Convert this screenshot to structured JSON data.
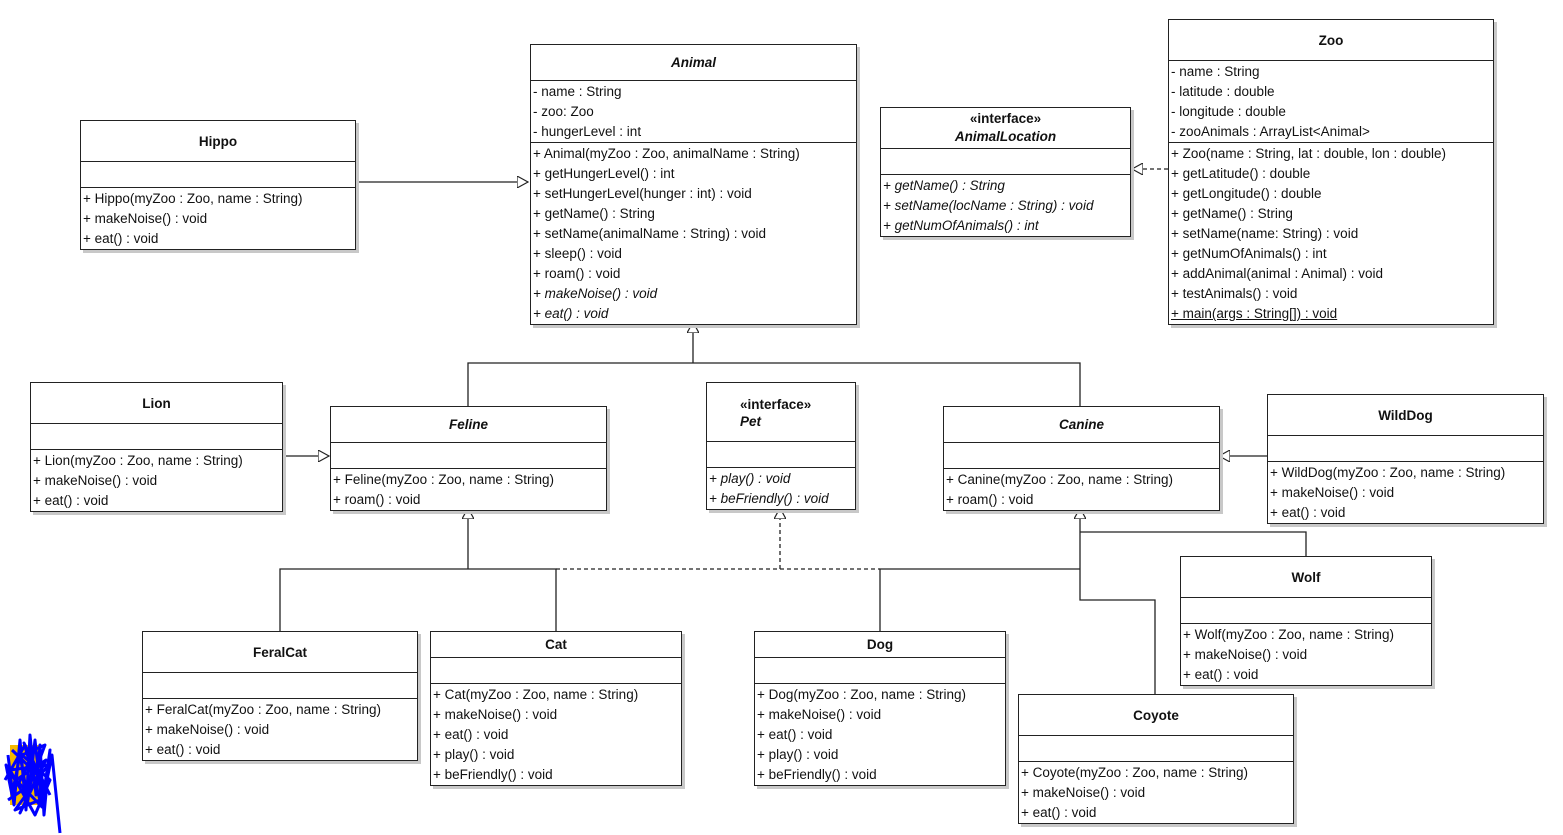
{
  "diagram": {
    "type": "UML class diagram",
    "classes": {
      "animal": {
        "name": "Animal",
        "abstract": true,
        "attributes": [
          "- name : String",
          "- zoo: Zoo",
          "- hungerLevel : int"
        ],
        "operations": [
          {
            "text": "+ Animal(myZoo : Zoo, animalName : String)"
          },
          {
            "text": "+ getHungerLevel() : int"
          },
          {
            "text": "+ setHungerLevel(hunger : int) : void"
          },
          {
            "text": "+ getName() : String"
          },
          {
            "text": "+ setName(animalName : String) : void"
          },
          {
            "text": "+ sleep() : void"
          },
          {
            "text": "+ roam() : void"
          },
          {
            "text": "+ makeNoise() : void",
            "italic": true
          },
          {
            "text": "+ eat() : void",
            "italic": true
          }
        ]
      },
      "zoo": {
        "name": "Zoo",
        "abstract": false,
        "attributes": [
          "- name : String",
          "- latitude : double",
          "- longitude : double",
          "- zooAnimals : ArrayList<Animal>"
        ],
        "operations": [
          {
            "text": "+ Zoo(name : String, lat : double, lon : double)"
          },
          {
            "text": "+ getLatitude() : double"
          },
          {
            "text": "+ getLongitude() : double"
          },
          {
            "text": "+ getName() : String"
          },
          {
            "text": "+ setName(name: String) : void"
          },
          {
            "text": "+ getNumOfAnimals() : int"
          },
          {
            "text": "+ addAnimal(animal : Animal) : void"
          },
          {
            "text": "+ testAnimals() : void"
          },
          {
            "text": "+ main(args : String[]) : void",
            "underline": true
          }
        ]
      },
      "animalLocation": {
        "name": "AnimalLocation",
        "stereotype": "«interface»",
        "attributes": [],
        "operations": [
          {
            "text": "+ getName() : String",
            "italic": true
          },
          {
            "text": "+ setName(locName : String) : void",
            "italic": true
          },
          {
            "text": "+ getNumOfAnimals() : int",
            "italic": true
          }
        ]
      },
      "hippo": {
        "name": "Hippo",
        "attributes": [],
        "operations": [
          {
            "text": "+ Hippo(myZoo : Zoo, name : String)"
          },
          {
            "text": "+ makeNoise() : void"
          },
          {
            "text": "+ eat() : void"
          }
        ]
      },
      "lion": {
        "name": "Lion",
        "attributes": [],
        "operations": [
          {
            "text": "+ Lion(myZoo : Zoo, name : String)"
          },
          {
            "text": "+ makeNoise() : void"
          },
          {
            "text": "+ eat() : void"
          }
        ]
      },
      "feline": {
        "name": "Feline",
        "abstract": true,
        "attributes": [],
        "operations": [
          {
            "text": "+ Feline(myZoo : Zoo, name : String)"
          },
          {
            "text": "+ roam() : void"
          }
        ]
      },
      "pet": {
        "name": "Pet",
        "stereotype": "«interface»",
        "attributes": [],
        "operations": [
          {
            "text": "+ play() : void",
            "italic": true
          },
          {
            "text": "+ beFriendly() : void",
            "italic": true
          }
        ]
      },
      "canine": {
        "name": "Canine",
        "abstract": true,
        "attributes": [],
        "operations": [
          {
            "text": "+ Canine(myZoo : Zoo, name : String)"
          },
          {
            "text": "+ roam() : void"
          }
        ]
      },
      "wildDog": {
        "name": "WildDog",
        "attributes": [],
        "operations": [
          {
            "text": "+ WildDog(myZoo : Zoo, name : String)"
          },
          {
            "text": "+ makeNoise() : void"
          },
          {
            "text": "+ eat() : void"
          }
        ]
      },
      "feralCat": {
        "name": "FeralCat",
        "attributes": [],
        "operations": [
          {
            "text": "+ FeralCat(myZoo : Zoo, name : String)"
          },
          {
            "text": "+ makeNoise() : void"
          },
          {
            "text": "+ eat() : void"
          }
        ]
      },
      "cat": {
        "name": "Cat",
        "attributes": [],
        "operations": [
          {
            "text": "+ Cat(myZoo : Zoo, name : String)"
          },
          {
            "text": "+ makeNoise() : void"
          },
          {
            "text": "+ eat() : void"
          },
          {
            "text": "+ play() : void"
          },
          {
            "text": "+ beFriendly() : void"
          }
        ]
      },
      "dog": {
        "name": "Dog",
        "attributes": [],
        "operations": [
          {
            "text": "+ Dog(myZoo : Zoo, name : String)"
          },
          {
            "text": "+ makeNoise() : void"
          },
          {
            "text": "+ eat() : void"
          },
          {
            "text": "+ play() : void"
          },
          {
            "text": "+ beFriendly() : void"
          }
        ]
      },
      "wolf": {
        "name": "Wolf",
        "attributes": [],
        "operations": [
          {
            "text": "+ Wolf(myZoo : Zoo, name : String)"
          },
          {
            "text": "+ makeNoise() : void"
          },
          {
            "text": "+ eat() : void"
          }
        ]
      },
      "coyote": {
        "name": "Coyote",
        "attributes": [],
        "operations": [
          {
            "text": "+ Coyote(myZoo : Zoo, name : String)"
          },
          {
            "text": "+ makeNoise() : void"
          },
          {
            "text": "+ eat() : void"
          }
        ]
      }
    },
    "relationships": [
      {
        "from": "Hippo",
        "to": "Animal",
        "kind": "generalization"
      },
      {
        "from": "Feline",
        "to": "Animal",
        "kind": "generalization"
      },
      {
        "from": "Canine",
        "to": "Animal",
        "kind": "generalization"
      },
      {
        "from": "Zoo",
        "to": "AnimalLocation",
        "kind": "realization"
      },
      {
        "from": "Lion",
        "to": "Feline",
        "kind": "generalization"
      },
      {
        "from": "FeralCat",
        "to": "Feline",
        "kind": "generalization"
      },
      {
        "from": "Cat",
        "to": "Feline",
        "kind": "generalization"
      },
      {
        "from": "Cat",
        "to": "Pet",
        "kind": "realization"
      },
      {
        "from": "Dog",
        "to": "Pet",
        "kind": "realization"
      },
      {
        "from": "Dog",
        "to": "Canine",
        "kind": "generalization"
      },
      {
        "from": "WildDog",
        "to": "Canine",
        "kind": "generalization"
      },
      {
        "from": "Wolf",
        "to": "Canine",
        "kind": "generalization"
      },
      {
        "from": "Coyote",
        "to": "Canine",
        "kind": "generalization"
      }
    ],
    "colors": {
      "line": "#222222",
      "shadow": "#c8c8c8",
      "scribble": "#0000ff",
      "scribble_under": "#f5b800"
    }
  }
}
